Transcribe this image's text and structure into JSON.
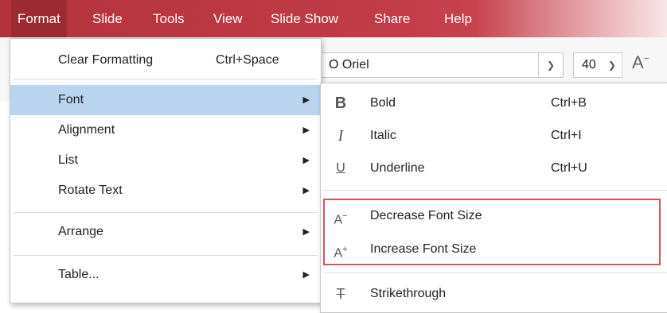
{
  "menubar": {
    "items": [
      "Format",
      "Slide",
      "Tools",
      "View",
      "Slide Show",
      "Share",
      "Help"
    ]
  },
  "toolbar": {
    "font_name": "O Oriel",
    "font_size": "40",
    "decrease_icon": "A",
    "decrease_sup": "−"
  },
  "format_menu": {
    "clear_formatting": {
      "label": "Clear Formatting",
      "shortcut": "Ctrl+Space"
    },
    "font": "Font",
    "alignment": "Alignment",
    "list": "List",
    "rotate_text": "Rotate Text",
    "arrange": "Arrange",
    "table": "Table..."
  },
  "font_menu": {
    "bold": {
      "icon": "B",
      "label": "Bold",
      "shortcut": "Ctrl+B"
    },
    "italic": {
      "icon": "I",
      "label": "Italic",
      "shortcut": "Ctrl+I"
    },
    "underline": {
      "icon": "U",
      "label": "Underline",
      "shortcut": "Ctrl+U"
    },
    "decrease": {
      "icon": "A",
      "icon_sup": "−",
      "label": "Decrease Font Size"
    },
    "increase": {
      "icon": "A",
      "icon_sup": "+",
      "label": "Increase Font Size"
    },
    "strikethrough": {
      "icon": "T",
      "label": "Strikethrough"
    }
  },
  "colors": {
    "menubar": "#c23c48",
    "highlight": "#bad4f0",
    "annotation_box": "#d1555f"
  }
}
